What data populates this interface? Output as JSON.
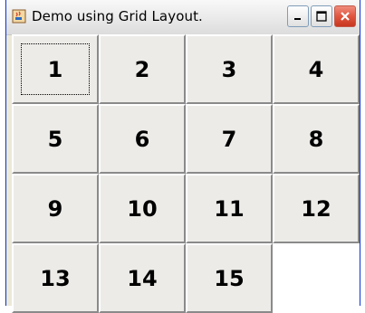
{
  "window": {
    "title": "Demo using Grid Layout.",
    "icon": "java-cup-icon",
    "controls": [
      "minimize",
      "maximize",
      "close"
    ]
  },
  "buttons": [
    "1",
    "2",
    "3",
    "4",
    "5",
    "6",
    "7",
    "8",
    "9",
    "10",
    "11",
    "12",
    "13",
    "14",
    "15"
  ],
  "focused_button": "1"
}
